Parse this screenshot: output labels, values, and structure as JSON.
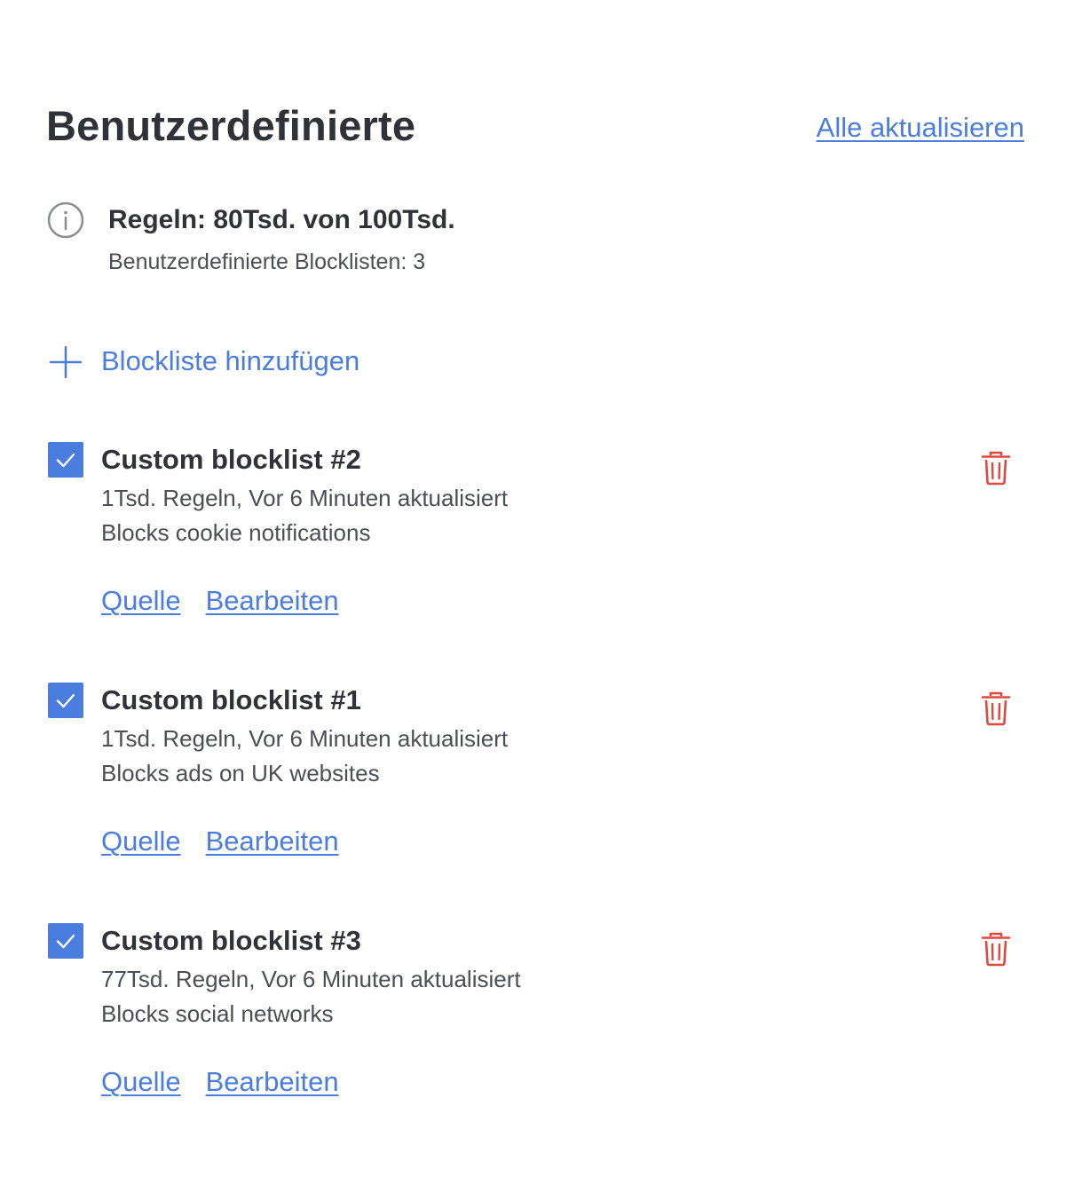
{
  "header": {
    "title": "Benutzerdefinierte",
    "update_all_label": "Alle aktualisieren"
  },
  "info": {
    "icon": "info-icon",
    "rules": "Regeln: 80Tsd. von 100Tsd.",
    "count": "Benutzerdefinierte Blocklisten: 3"
  },
  "add": {
    "icon": "plus-icon",
    "label": "Blockliste hinzufügen"
  },
  "blocklists": [
    {
      "checked": true,
      "title": "Custom blocklist #2",
      "meta": "1Tsd. Regeln, Vor 6 Minuten aktualisiert",
      "description": "Blocks cookie notifications",
      "source_label": "Quelle",
      "edit_label": "Bearbeiten"
    },
    {
      "checked": true,
      "title": "Custom blocklist #1",
      "meta": "1Tsd. Regeln, Vor 6 Minuten aktualisiert",
      "description": "Blocks ads on UK websites",
      "source_label": "Quelle",
      "edit_label": "Bearbeiten"
    },
    {
      "checked": true,
      "title": "Custom blocklist #3",
      "meta": "77Tsd. Regeln, Vor 6 Minuten aktualisiert",
      "description": "Blocks social networks",
      "source_label": "Quelle",
      "edit_label": "Bearbeiten"
    }
  ],
  "colors": {
    "accent": "#4a7ddd",
    "text": "#2f3337",
    "secondary_text": "#4a4f55",
    "delete": "#e0483e"
  }
}
